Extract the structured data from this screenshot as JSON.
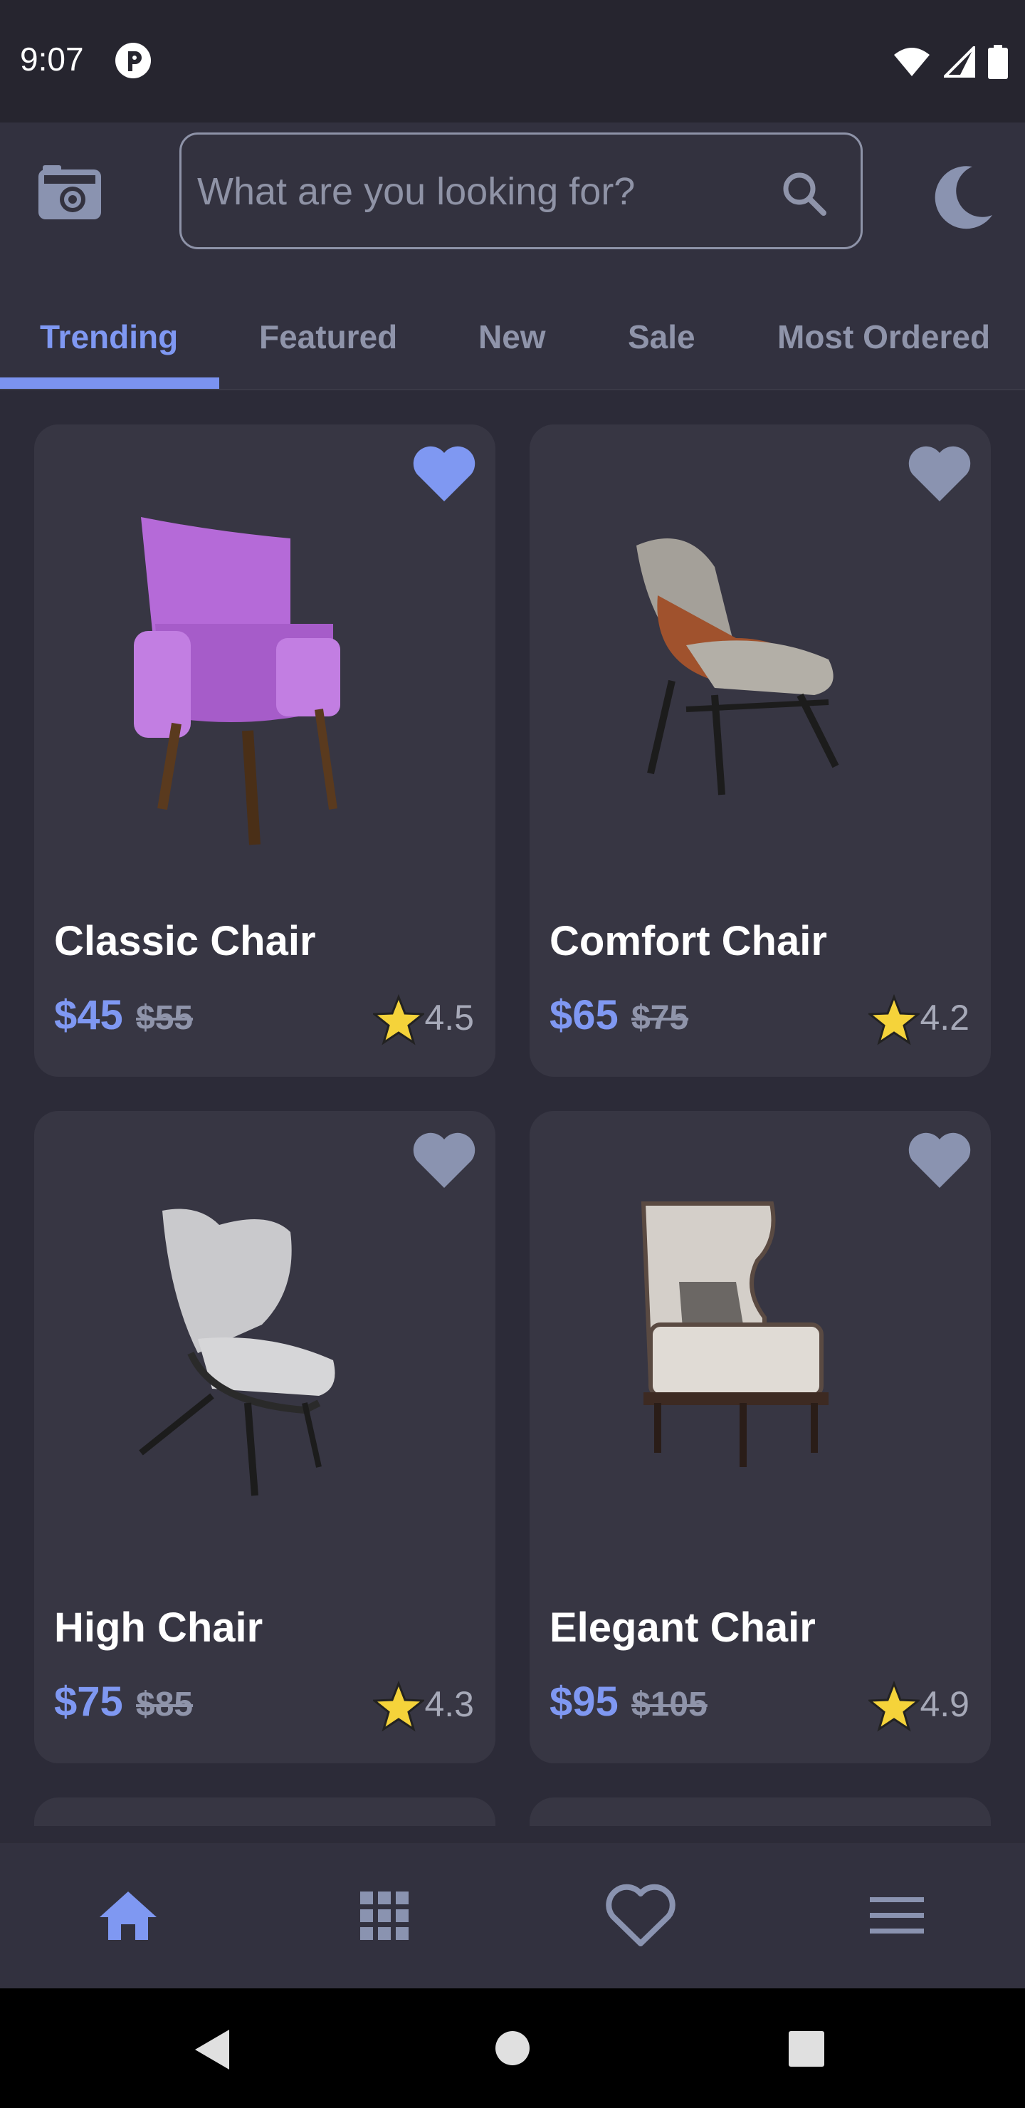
{
  "status_bar": {
    "time": "9:07"
  },
  "search": {
    "placeholder": "What are you looking for?"
  },
  "tabs": [
    {
      "label": "Trending",
      "active": true
    },
    {
      "label": "Featured",
      "active": false
    },
    {
      "label": "New",
      "active": false
    },
    {
      "label": "Sale",
      "active": false
    },
    {
      "label": "Most Ordered",
      "active": false
    }
  ],
  "products": [
    {
      "name": "Classic Chair",
      "price": "$45",
      "old_price": "$55",
      "rating": "4.5",
      "favorite": true,
      "chair_color": "#b56ad8"
    },
    {
      "name": "Comfort Chair",
      "price": "$65",
      "old_price": "$75",
      "rating": "4.2",
      "favorite": false,
      "chair_color": "#a4a099"
    },
    {
      "name": "High Chair",
      "price": "$75",
      "old_price": "$85",
      "rating": "4.3",
      "favorite": false,
      "chair_color": "#c9c9cc"
    },
    {
      "name": "Elegant Chair",
      "price": "$95",
      "old_price": "$105",
      "rating": "4.9",
      "favorite": false,
      "chair_color": "#d4cfc9"
    }
  ],
  "bottom_nav": [
    {
      "icon": "home-icon",
      "active": true
    },
    {
      "icon": "grid-icon",
      "active": false
    },
    {
      "icon": "heart-icon",
      "active": false
    },
    {
      "icon": "menu-icon",
      "active": false
    }
  ],
  "colors": {
    "accent": "#7b93f0",
    "muted": "#8f94aa",
    "background": "#2c2b38",
    "card": "#373643",
    "star": "#f5d33a"
  }
}
